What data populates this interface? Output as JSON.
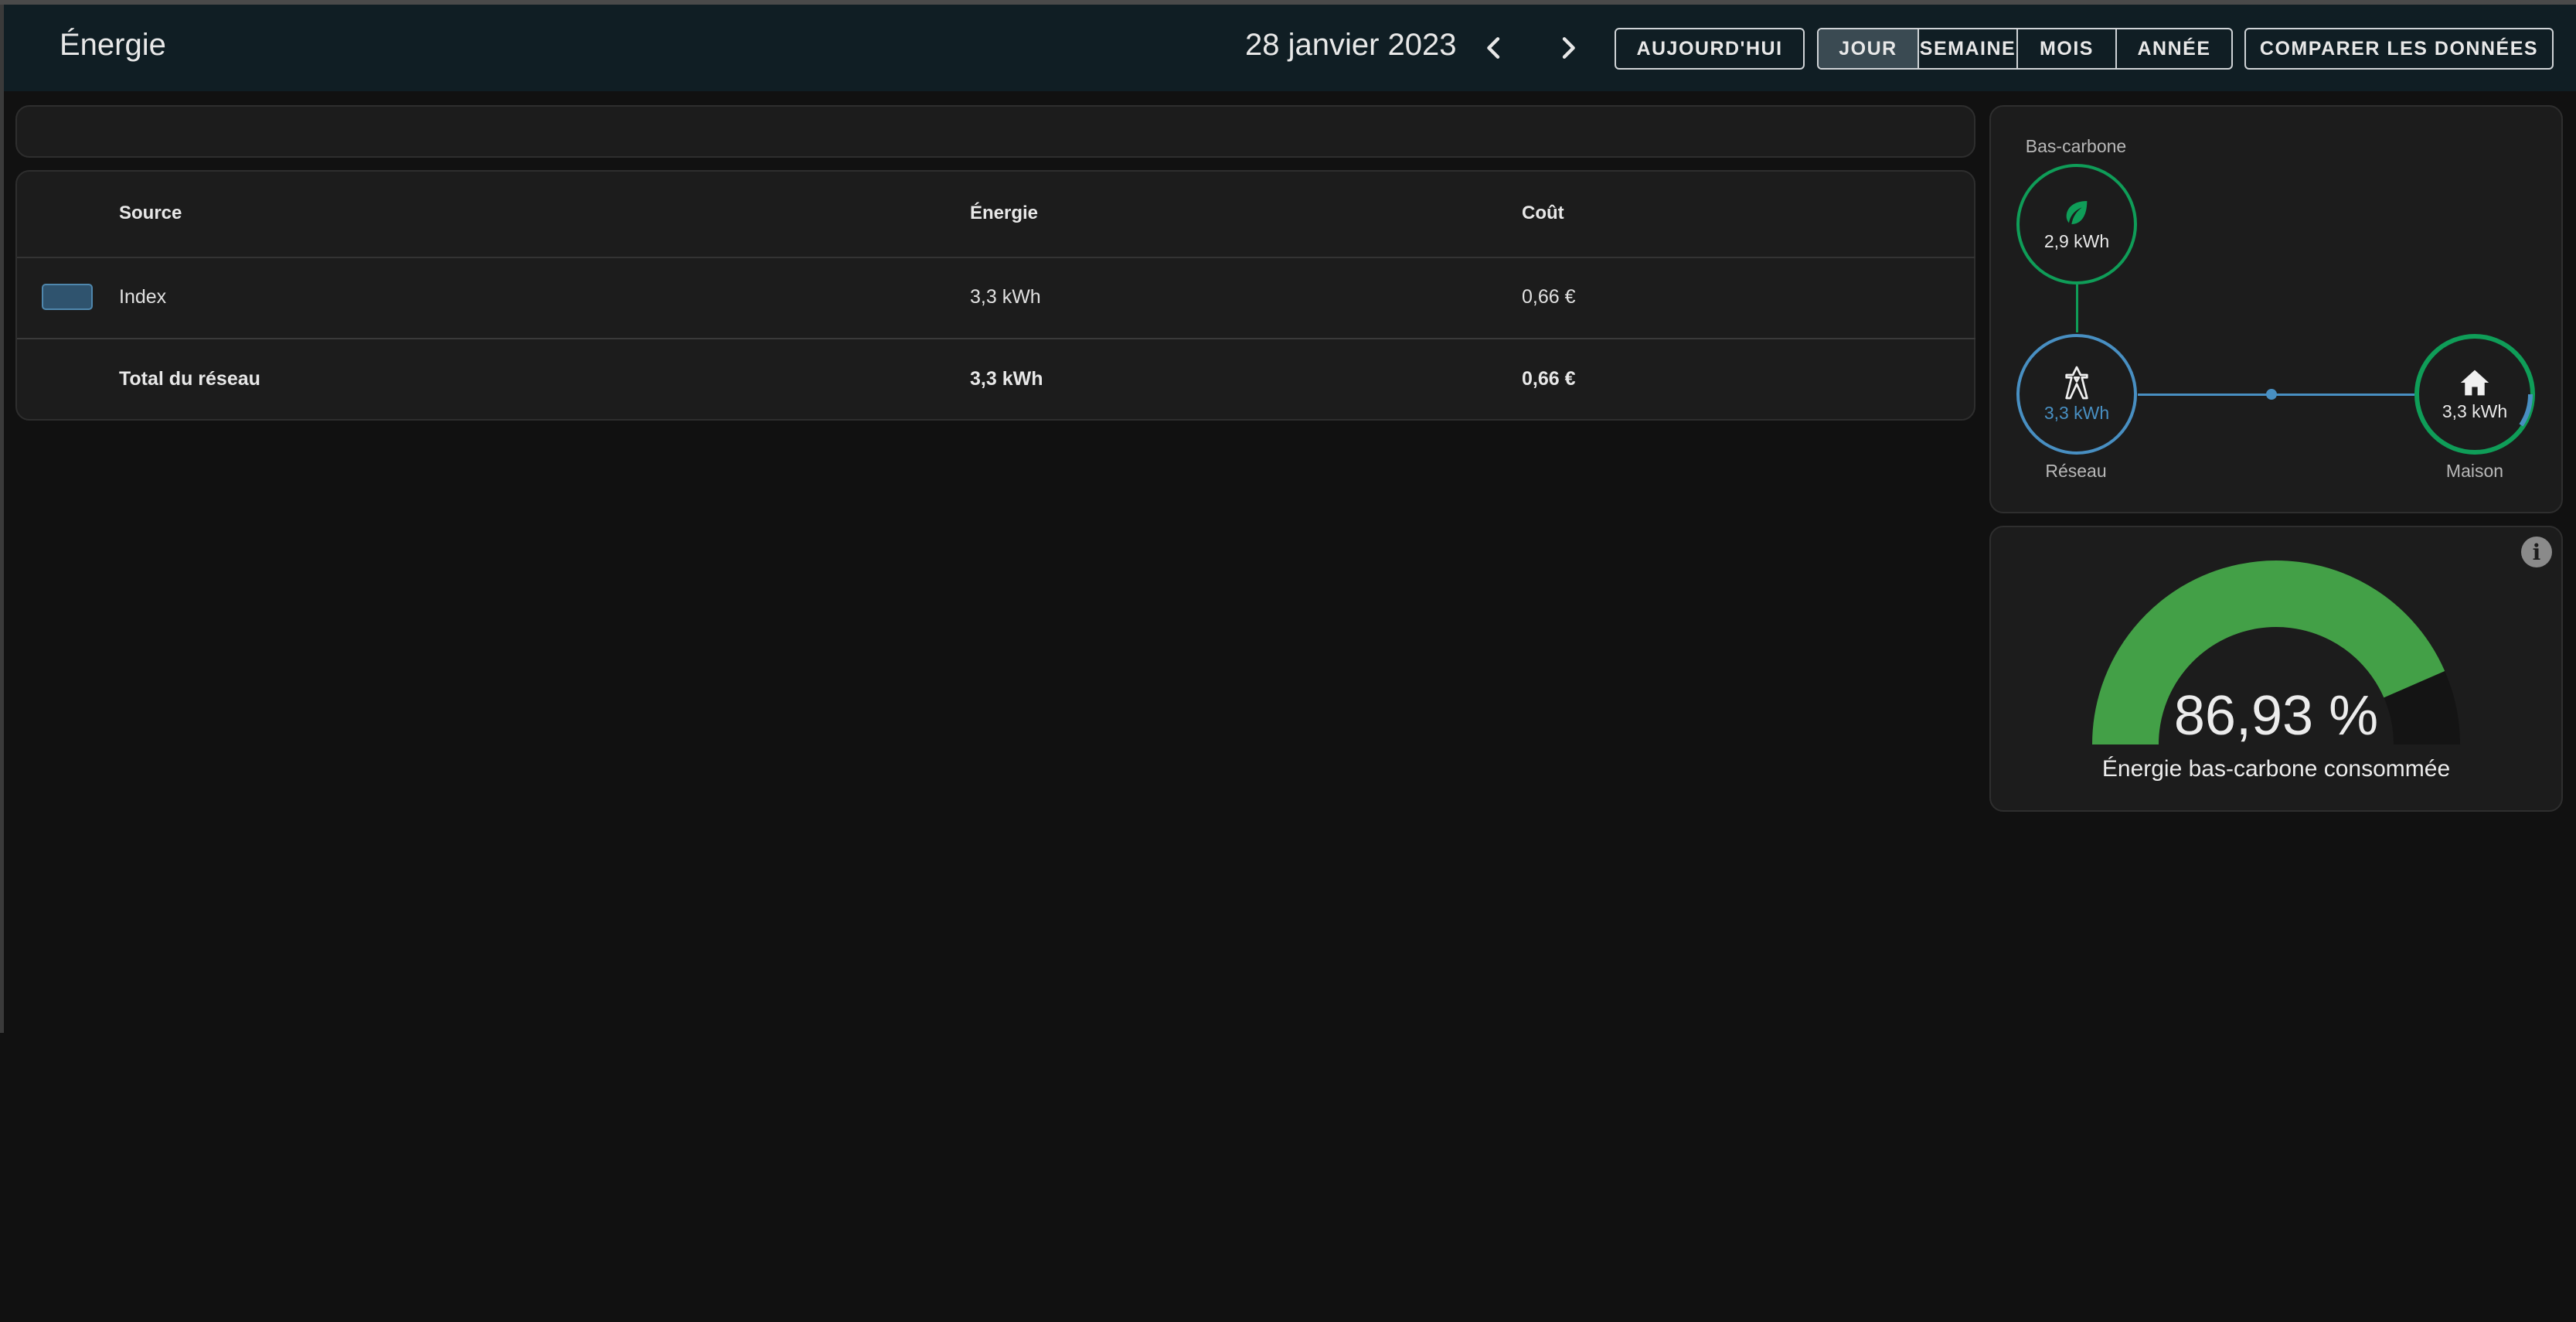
{
  "header": {
    "title": "Énergie",
    "date": "28 janvier 2023",
    "today_label": "AUJOURD'HUI",
    "periods": [
      "JOUR",
      "SEMAINE",
      "MOIS",
      "ANNÉE"
    ],
    "compare_label": "COMPARER LES DONNÉES"
  },
  "table": {
    "columns": {
      "source": "Source",
      "energy": "Énergie",
      "cost": "Coût"
    },
    "rows": [
      {
        "source": "Index",
        "energy": "3,3 kWh",
        "cost": "0,66 €"
      }
    ],
    "total": {
      "label": "Total du réseau",
      "energy": "3,3 kWh",
      "cost": "0,66 €"
    }
  },
  "flow": {
    "low_carbon": {
      "label": "Bas-carbone",
      "value": "2,9 kWh"
    },
    "grid": {
      "label": "Réseau",
      "value": "3,3 kWh"
    },
    "home": {
      "label": "Maison",
      "value": "3,3 kWh"
    }
  },
  "gauge": {
    "value_text": "86,93 %",
    "percent": 86.93,
    "caption": "Énergie bas-carbone consommée"
  },
  "colors": {
    "accent_green": "#0f9d58",
    "grid_blue": "#488fc2",
    "gauge_green": "#43a047",
    "swatch": "#2f536e"
  }
}
